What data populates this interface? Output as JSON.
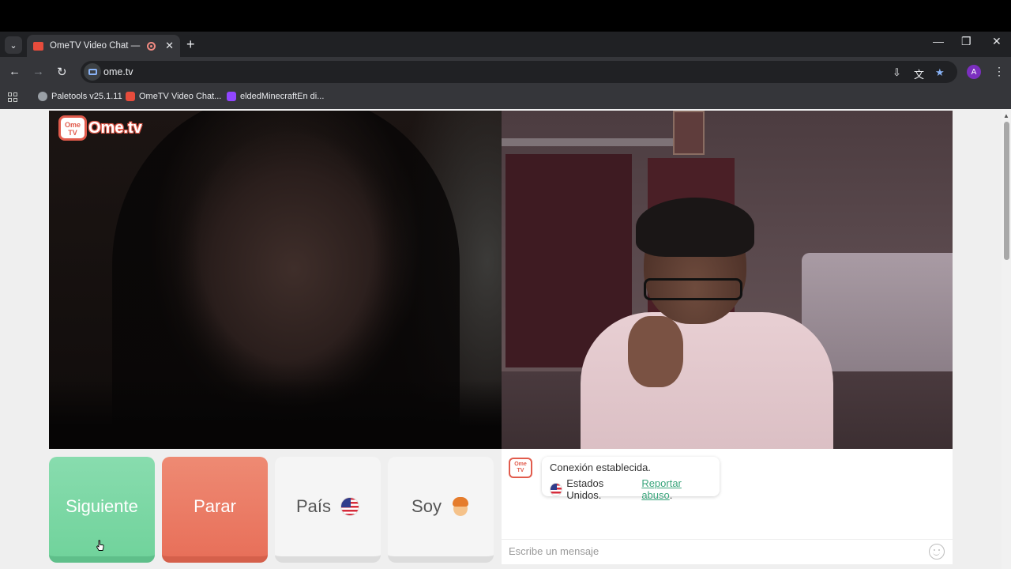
{
  "browser": {
    "tab": {
      "title": "OmeTV Video Chat — OmeTV"
    },
    "address": {
      "url": "ome.tv"
    },
    "profile_initial": "A",
    "bookmarks": [
      {
        "label": "Paletools v25.1.11",
        "color": "#9aa0a6"
      },
      {
        "label": "OmeTV Video Chat...",
        "color": "#e74c3c"
      },
      {
        "label": "eldedMinecraftEn di...",
        "color": "#9146ff"
      }
    ]
  },
  "logo": {
    "badge": "Ome TV",
    "text": "Ome.tv"
  },
  "controls": {
    "next_label": "Siguiente",
    "stop_label": "Parar",
    "country_label": "País",
    "gender_label": "Soy"
  },
  "chat": {
    "logo_badge": "Ome TV",
    "status": "Conexión establecida.",
    "country": "Estados Unidos.",
    "report_link": "Reportar abuso",
    "trailing": ".",
    "input_placeholder": "Escribe un mensaje"
  },
  "colors": {
    "next": "#71d39c",
    "stop": "#e8705a",
    "link": "#3aa57c",
    "brand": "#e15b4c"
  }
}
